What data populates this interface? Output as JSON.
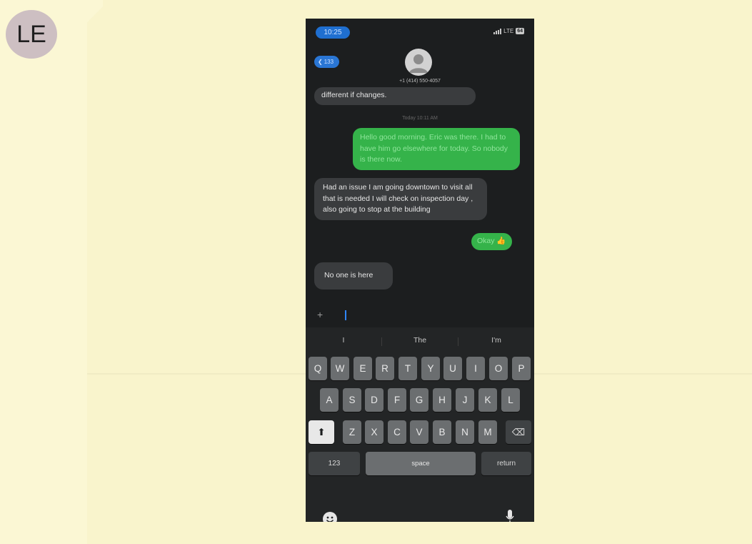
{
  "exhibit": {
    "label": "LE"
  },
  "status_bar": {
    "time": "10:25",
    "network": "LTE",
    "battery": "64"
  },
  "header": {
    "back_count": "133",
    "contact": "+1 (414) 550-4057"
  },
  "messages": [
    {
      "from": "contact",
      "text": "different if changes."
    },
    {
      "from": "system",
      "text": "Today 10:11 AM"
    },
    {
      "from": "me",
      "text": "Hello good morning. Eric was there. I had to have him go elsewhere for today. So nobody is there now."
    },
    {
      "from": "contact",
      "text": "Had an issue I am going downtown to visit all that is needed I will check on inspection day , also going to stop at the building"
    },
    {
      "from": "me",
      "text": "Okay 👍"
    },
    {
      "from": "contact",
      "text": "No one is here"
    }
  ],
  "compose": {
    "hint": ""
  },
  "keyboard": {
    "suggestions": [
      "I",
      "The",
      "I'm"
    ],
    "row1": [
      "Q",
      "W",
      "E",
      "R",
      "T",
      "Y",
      "U",
      "I",
      "O",
      "P"
    ],
    "row2": [
      "A",
      "S",
      "D",
      "F",
      "G",
      "H",
      "J",
      "K",
      "L"
    ],
    "row3": [
      "Z",
      "X",
      "C",
      "V",
      "B",
      "N",
      "M"
    ],
    "numbers_key": "123",
    "space_key": "space",
    "return_key": "return",
    "shift_glyph": "⬆",
    "delete_glyph": "⌫"
  }
}
